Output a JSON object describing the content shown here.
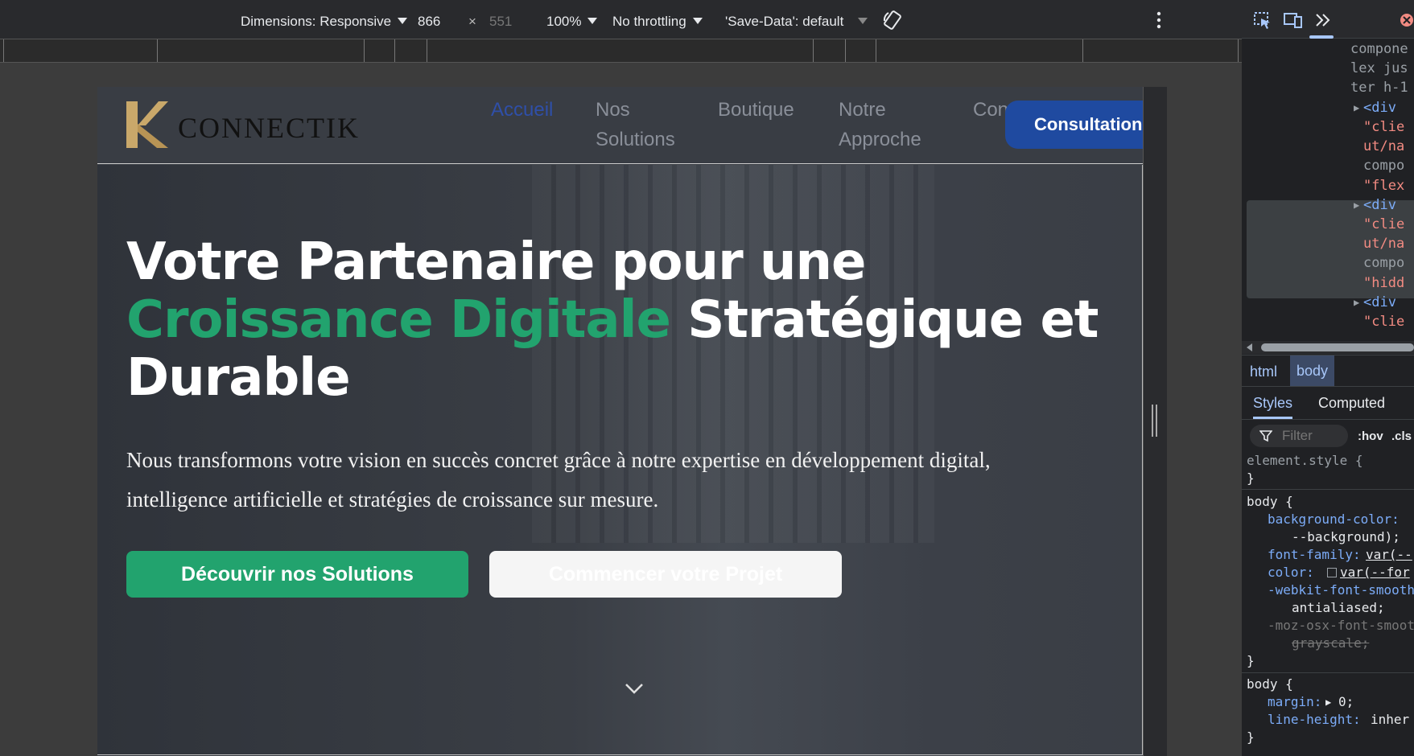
{
  "device_toolbar": {
    "dimensions_label": "Dimensions: Responsive",
    "width_value": "866",
    "times_sign": "×",
    "height_value": "551",
    "zoom": "100%",
    "throttling": "No throttling",
    "save_data": "'Save-Data': default"
  },
  "site": {
    "logo_letter": "K",
    "logo_text": "CONNECTIK",
    "nav": [
      {
        "label": "Accueil"
      },
      {
        "label": "Nos Solutions"
      },
      {
        "label": "Boutique"
      },
      {
        "label": "Notre Approche"
      },
      {
        "label": "Contact"
      }
    ],
    "cta": "Consultation",
    "hero": {
      "title_before": "Votre Partenaire pour une",
      "title_accent": "Croissance Digitale",
      "title_after": "Stratégique et Durable",
      "subtitle": "Nous transformons votre vision en succès concret grâce à notre expertise en développement digital, intelligence artificielle et stratégies de croissance sur mesure.",
      "primary_button": "Découvrir nos Solutions",
      "secondary_button": "Commencer votre Projet"
    },
    "colors": {
      "accent_green": "#22a36e",
      "brand_blue": "#1f4aa0",
      "logo_gold": "#c9a86a"
    }
  },
  "devtools": {
    "tree_lines": [
      {
        "text": "compone",
        "kind": "attr"
      },
      {
        "text": "lex jus",
        "kind": "attr"
      },
      {
        "text": "ter h-1",
        "kind": "attr"
      },
      {
        "text": "<div",
        "kind": "tag"
      },
      {
        "text": "\"clie",
        "kind": "str"
      },
      {
        "text": "ut/na",
        "kind": "str"
      },
      {
        "text": "compo",
        "kind": "attr"
      },
      {
        "text": "\"flex",
        "kind": "str"
      },
      {
        "text": "<div",
        "kind": "tag"
      },
      {
        "text": "\"clie",
        "kind": "str"
      },
      {
        "text": "ut/na",
        "kind": "str"
      },
      {
        "text": "compo",
        "kind": "attr"
      },
      {
        "text": "\"hidd",
        "kind": "str"
      },
      {
        "text": "<div",
        "kind": "tag"
      },
      {
        "text": "\"clie",
        "kind": "str"
      }
    ],
    "breadcrumbs": [
      "html",
      "body"
    ],
    "styles_tabs": [
      "Styles",
      "Computed"
    ],
    "filter_placeholder": "Filter",
    "filter_hov": ":hov",
    "filter_cls": ".cls",
    "css": {
      "element_style_sel": "element.style {",
      "close_brace": "}",
      "body_sel": "body {",
      "bg_prop": "background-color:",
      "bg_val": "--background);",
      "ff_prop": "font-family:",
      "ff_val": "var(--",
      "color_prop": "color:",
      "color_val": "var(--for",
      "smooth_prop": "-webkit-font-smooth",
      "smooth_val": "antialiased;",
      "moz_prop": "-moz-osx-font-smoot",
      "moz_val": "grayscale;",
      "body_sel2": "body {",
      "margin_prop": "margin:",
      "margin_val": "0;",
      "lh_prop": "line-height:",
      "lh_val": "inher"
    }
  }
}
